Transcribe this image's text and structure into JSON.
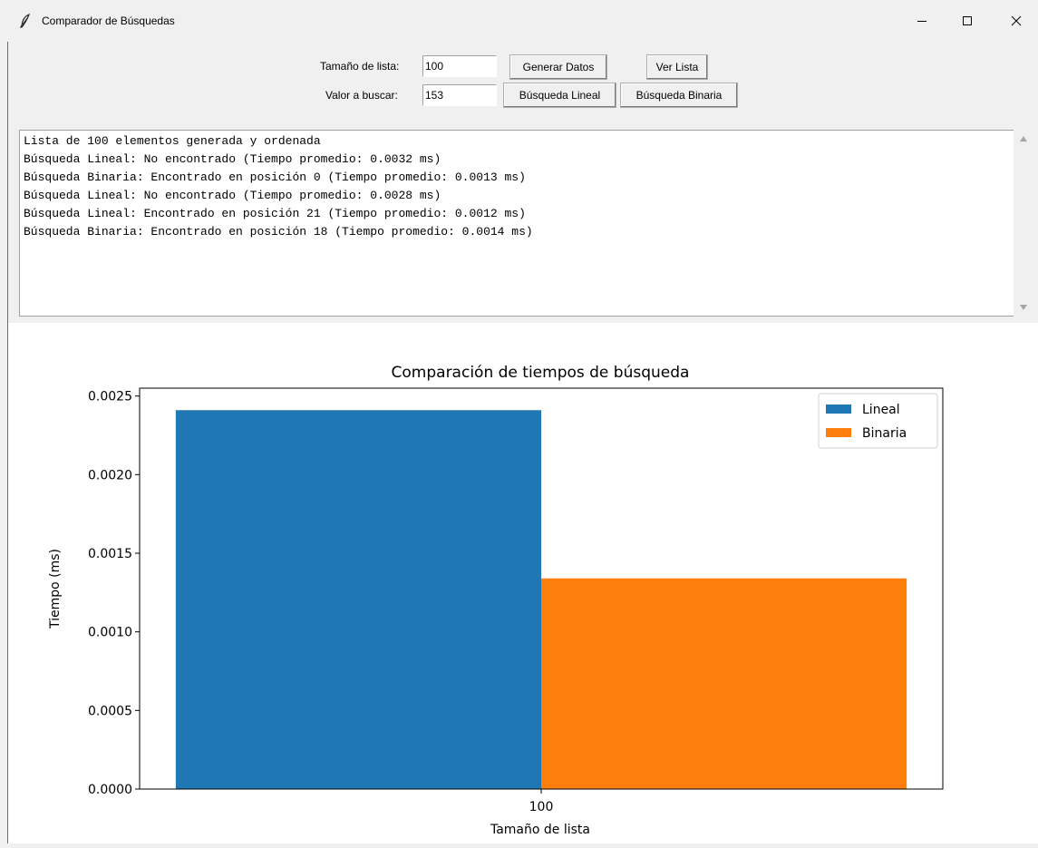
{
  "window": {
    "title": "Comparador de Búsquedas"
  },
  "controls": {
    "size_label": "Tamaño de lista:",
    "size_value": "100",
    "search_label": "Valor a buscar:",
    "search_value": "153",
    "generate_button": "Generar Datos",
    "view_list_button": "Ver Lista",
    "linear_search_button": "Búsqueda Lineal",
    "binary_search_button": "Búsqueda Binaria"
  },
  "log": {
    "lines": [
      "Lista de 100 elementos generada y ordenada",
      "Búsqueda Lineal: No encontrado (Tiempo promedio: 0.0032 ms)",
      "Búsqueda Binaria: Encontrado en posición 0 (Tiempo promedio: 0.0013 ms)",
      "Búsqueda Lineal: No encontrado (Tiempo promedio: 0.0028 ms)",
      "Búsqueda Lineal: Encontrado en posición 21 (Tiempo promedio: 0.0012 ms)",
      "Búsqueda Binaria: Encontrado en posición 18 (Tiempo promedio: 0.0014 ms)"
    ]
  },
  "chart_data": {
    "type": "bar",
    "title": "Comparación de tiempos de búsqueda",
    "xlabel": "Tamaño de lista",
    "ylabel": "Tiempo (ms)",
    "categories": [
      "100"
    ],
    "series": [
      {
        "name": "Lineal",
        "values": [
          0.00241
        ],
        "color": "#1f77b4"
      },
      {
        "name": "Binaria",
        "values": [
          0.00134
        ],
        "color": "#ff7f0e"
      }
    ],
    "ylim": [
      0,
      0.00255
    ],
    "yticks": [
      "0.0000",
      "0.0005",
      "0.0010",
      "0.0015",
      "0.0020",
      "0.0025"
    ],
    "ytick_values": [
      0,
      0.0005,
      0.001,
      0.0015,
      0.002,
      0.0025
    ],
    "legend": "top-right",
    "grid": false
  }
}
